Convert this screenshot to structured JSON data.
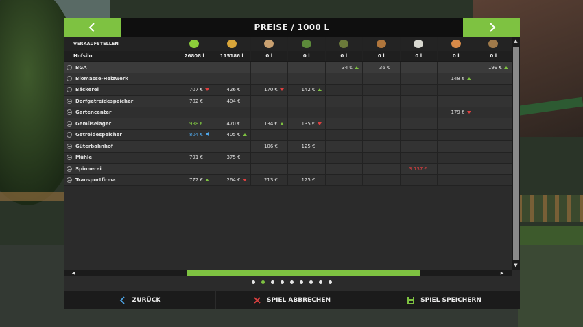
{
  "header": {
    "title": "PREISE / 1000 L"
  },
  "table": {
    "first_header": "VERKAUFSTELLEN",
    "goods_icons": [
      {
        "icon": "grass-icon",
        "color": "#8ccf3a"
      },
      {
        "icon": "wheat-icon",
        "color": "#d9a63a"
      },
      {
        "icon": "potato-icon",
        "color": "#c9a070"
      },
      {
        "icon": "sapling-icon",
        "color": "#5c8a3a"
      },
      {
        "icon": "seedling-icon",
        "color": "#6b7a3a"
      },
      {
        "icon": "crate-icon",
        "color": "#b0763c"
      },
      {
        "icon": "wool-icon",
        "color": "#d8d8d0"
      },
      {
        "icon": "bread-icon",
        "color": "#d88a48"
      },
      {
        "icon": "salad-bowl-icon",
        "color": "#a07a4a"
      }
    ],
    "silo": {
      "label": "Hofsilo",
      "values": [
        "26808 l",
        "115186 l",
        "0 l",
        "0 l",
        "0 l",
        "0 l",
        "0 l",
        "0 l",
        "0 l"
      ]
    },
    "rows": [
      {
        "name": "BGA",
        "cells": [
          [
            "",
            ""
          ],
          [
            "",
            ""
          ],
          [
            "",
            ""
          ],
          [
            "",
            ""
          ],
          [
            "34 €",
            "up"
          ],
          [
            "36 €",
            ""
          ],
          [
            "",
            ""
          ],
          [
            "",
            ""
          ],
          [
            "199 €",
            "up"
          ]
        ]
      },
      {
        "name": "Biomasse-Heizwerk",
        "cells": [
          [
            "",
            ""
          ],
          [
            "",
            ""
          ],
          [
            "",
            ""
          ],
          [
            "",
            ""
          ],
          [
            "",
            ""
          ],
          [
            "",
            ""
          ],
          [
            "",
            ""
          ],
          [
            "148 €",
            "up"
          ],
          [
            "",
            ""
          ]
        ]
      },
      {
        "name": "Bäckerei",
        "cells": [
          [
            "707 €",
            "down"
          ],
          [
            "426 €",
            ""
          ],
          [
            "170 €",
            "down"
          ],
          [
            "142 €",
            "up"
          ],
          [
            "",
            ""
          ],
          [
            "",
            ""
          ],
          [
            "",
            ""
          ],
          [
            "",
            ""
          ],
          [
            "",
            ""
          ]
        ]
      },
      {
        "name": "Dorfgetreidespeicher",
        "cells": [
          [
            "702 €",
            ""
          ],
          [
            "404 €",
            ""
          ],
          [
            "",
            ""
          ],
          [
            "",
            ""
          ],
          [
            "",
            ""
          ],
          [
            "",
            ""
          ],
          [
            "",
            ""
          ],
          [
            "",
            ""
          ],
          [
            "",
            ""
          ]
        ]
      },
      {
        "name": "Gartencenter",
        "cells": [
          [
            "",
            ""
          ],
          [
            "",
            ""
          ],
          [
            "",
            ""
          ],
          [
            "",
            ""
          ],
          [
            "",
            ""
          ],
          [
            "",
            ""
          ],
          [
            "",
            ""
          ],
          [
            "179 €",
            "down"
          ],
          [
            "",
            ""
          ]
        ]
      },
      {
        "name": "Gemüselager",
        "cells": [
          [
            "938 €",
            "",
            "green"
          ],
          [
            "470 €",
            ""
          ],
          [
            "134 €",
            "up"
          ],
          [
            "135 €",
            "down"
          ],
          [
            "",
            ""
          ],
          [
            "",
            ""
          ],
          [
            "",
            ""
          ],
          [
            "",
            ""
          ],
          [
            "",
            ""
          ]
        ]
      },
      {
        "name": "Getreidespeicher",
        "cells": [
          [
            "804 €",
            "left",
            "blue"
          ],
          [
            "405 €",
            "up"
          ],
          [
            "",
            ""
          ],
          [
            "",
            ""
          ],
          [
            "",
            ""
          ],
          [
            "",
            ""
          ],
          [
            "",
            ""
          ],
          [
            "",
            ""
          ],
          [
            "",
            ""
          ]
        ]
      },
      {
        "name": "Güterbahnhof",
        "cells": [
          [
            "",
            ""
          ],
          [
            "",
            ""
          ],
          [
            "106 €",
            ""
          ],
          [
            "125 €",
            ""
          ],
          [
            "",
            ""
          ],
          [
            "",
            ""
          ],
          [
            "",
            ""
          ],
          [
            "",
            ""
          ],
          [
            "",
            ""
          ]
        ]
      },
      {
        "name": "Mühle",
        "cells": [
          [
            "791 €",
            ""
          ],
          [
            "375 €",
            ""
          ],
          [
            "",
            ""
          ],
          [
            "",
            ""
          ],
          [
            "",
            ""
          ],
          [
            "",
            ""
          ],
          [
            "",
            ""
          ],
          [
            "",
            ""
          ],
          [
            "",
            ""
          ]
        ]
      },
      {
        "name": "Spinnerei",
        "cells": [
          [
            "",
            ""
          ],
          [
            "",
            ""
          ],
          [
            "",
            ""
          ],
          [
            "",
            ""
          ],
          [
            "",
            ""
          ],
          [
            "",
            ""
          ],
          [
            "3.137 €",
            "",
            "red"
          ],
          [
            "",
            ""
          ],
          [
            "",
            ""
          ]
        ]
      },
      {
        "name": "Transportfirma",
        "cells": [
          [
            "772 €",
            "up"
          ],
          [
            "264 €",
            "down"
          ],
          [
            "213 €",
            ""
          ],
          [
            "125 €",
            ""
          ],
          [
            "",
            ""
          ],
          [
            "",
            ""
          ],
          [
            "",
            ""
          ],
          [
            "",
            ""
          ],
          [
            "",
            ""
          ]
        ]
      }
    ]
  },
  "pagination": {
    "count": 9,
    "active_index": 1
  },
  "footer": {
    "back_label": "ZURÜCK",
    "cancel_label": "SPIEL ABBRECHEN",
    "save_label": "SPIEL SPEICHERN"
  },
  "colors": {
    "accent": "#7ec241",
    "up": "#7ec241",
    "down": "#e04040",
    "blue": "#4fa6e8",
    "red": "#e04040"
  }
}
